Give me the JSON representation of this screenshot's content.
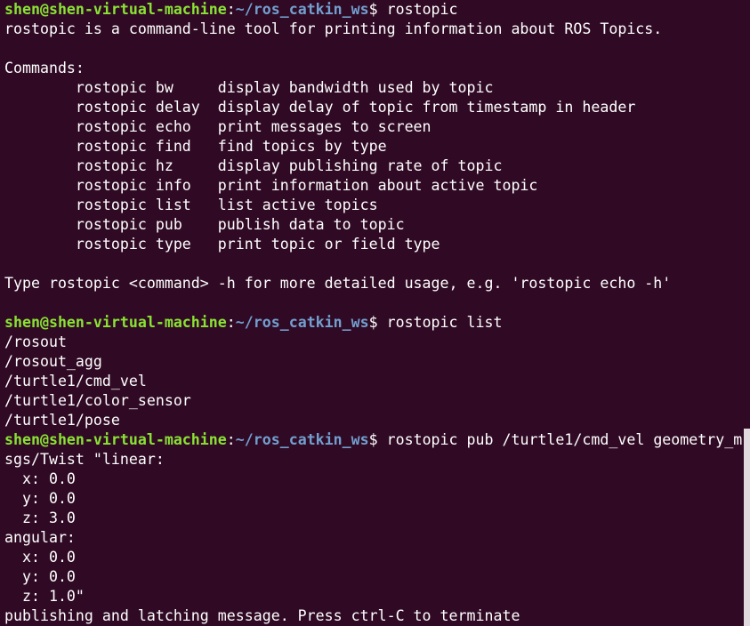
{
  "prompt": {
    "user_host": "shen@shen-virtual-machine",
    "separator": ":",
    "path": "~/ros_catkin_ws",
    "symbol": "$ "
  },
  "cmd1": "rostopic",
  "help_intro": "rostopic is a command-line tool for printing information about ROS Topics.",
  "commands_header": "Commands:",
  "commands": [
    "        rostopic bw     display bandwidth used by topic",
    "        rostopic delay  display delay of topic from timestamp in header",
    "        rostopic echo   print messages to screen",
    "        rostopic find   find topics by type",
    "        rostopic hz     display publishing rate of topic",
    "        rostopic info   print information about active topic",
    "        rostopic list   list active topics",
    "        rostopic pub    publish data to topic",
    "        rostopic type   print topic or field type"
  ],
  "help_footer": "Type rostopic <command> -h for more detailed usage, e.g. 'rostopic echo -h'",
  "cmd2": "rostopic list",
  "topics": [
    "/rosout",
    "/rosout_agg",
    "/turtle1/cmd_vel",
    "/turtle1/color_sensor",
    "/turtle1/pose"
  ],
  "cmd3": "rostopic pub /turtle1/cmd_vel geometry_m",
  "cmd3_continued": [
    "sgs/Twist \"linear:",
    "  x: 0.0",
    "  y: 0.0",
    "  z: 3.0",
    "angular:",
    "  x: 0.0",
    "  y: 0.0",
    "  z: 1.0\""
  ],
  "status": "publishing and latching message. Press ctrl-C to terminate"
}
